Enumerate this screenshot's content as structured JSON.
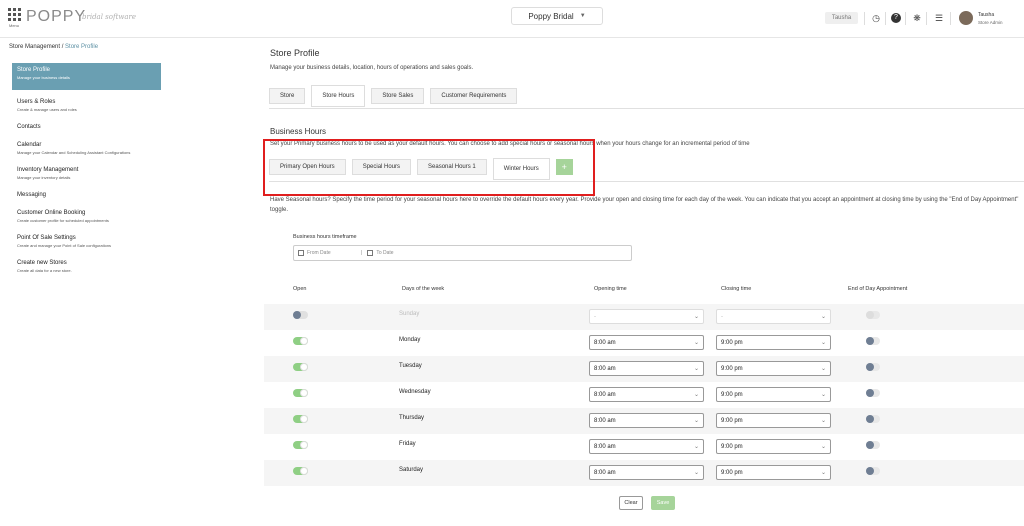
{
  "header": {
    "menu_label": "Menu",
    "logo": "POPPY",
    "logo_sub": "bridal software",
    "store_name": "Poppy Bridal",
    "user_chip": "Tausha",
    "user_name": "Tausha",
    "user_role": "Store Admin",
    "icons": [
      "clock-icon",
      "help-icon",
      "bug-icon",
      "list-icon"
    ]
  },
  "breadcrumb": {
    "parent": "Store Management",
    "separator": "/",
    "current": "Store Profile"
  },
  "sidebar": {
    "items": [
      {
        "title": "Store Profile",
        "desc": "Manage your business details"
      },
      {
        "title": "Users & Roles",
        "desc": "Create & manage users and roles"
      },
      {
        "title": "Contacts",
        "desc": ""
      },
      {
        "title": "Calendar",
        "desc": "Manage your Calendar and Scheduling Assistant Configurations"
      },
      {
        "title": "Inventory Management",
        "desc": "Manage your inventory details"
      },
      {
        "title": "Messaging",
        "desc": ""
      },
      {
        "title": "Customer Online Booking",
        "desc": "Create customer profile for scheduled appointments"
      },
      {
        "title": "Point Of Sale Settings",
        "desc": "Create and manage your Point of Sale configurations"
      },
      {
        "title": "Create new Stores",
        "desc": "Create all data for a new store."
      }
    ]
  },
  "main": {
    "title": "Store Profile",
    "subtitle": "Manage your business details, location, hours of operations and sales goals.",
    "tabs": [
      "Store",
      "Store Hours",
      "Store Sales",
      "Customer Requirements"
    ],
    "section_title": "Business Hours",
    "section_desc": "Set your Primary business hours to be used as your default hours. You can choose to add special hours or seasonal hours when your hours change for an incremental period of time",
    "subtabs": [
      "Primary Open Hours",
      "Special Hours",
      "Seasonal Hours 1",
      "Winter Hours"
    ],
    "add_label": "+",
    "seasonal_desc": "Have Seasonal hours? Specify the time period for your seasonal hours here to override the default hours every year. Provide your open and closing time for each day of the week. You can indicate that you accept an appointment at closing time by using the \"End of Day Appointment\" toggle.",
    "timeframe_label": "Business hours timeframe",
    "from_placeholder": "From Date",
    "to_placeholder": "To Date",
    "columns": [
      "Open",
      "Days of the week",
      "Opening time",
      "Closing time",
      "End of Day Appointment"
    ],
    "rows": [
      {
        "day": "Sunday",
        "open": false,
        "opening": "-",
        "closing": "-"
      },
      {
        "day": "Monday",
        "open": true,
        "opening": "8:00 am",
        "closing": "9:00 pm"
      },
      {
        "day": "Tuesday",
        "open": true,
        "opening": "8:00 am",
        "closing": "9:00 pm"
      },
      {
        "day": "Wednesday",
        "open": true,
        "opening": "8:00 am",
        "closing": "9:00 pm"
      },
      {
        "day": "Thursday",
        "open": true,
        "opening": "8:00 am",
        "closing": "9:00 pm"
      },
      {
        "day": "Friday",
        "open": true,
        "opening": "8:00 am",
        "closing": "9:00 pm"
      },
      {
        "day": "Saturday",
        "open": true,
        "opening": "8:00 am",
        "closing": "9:00 pm"
      }
    ],
    "clear_label": "Clear",
    "save_label": "Save"
  },
  "colors": {
    "accent": "#6a9fb2",
    "toggle_on": "#8fcf84",
    "highlight": "#e01e1e",
    "save": "#a6d49a"
  }
}
